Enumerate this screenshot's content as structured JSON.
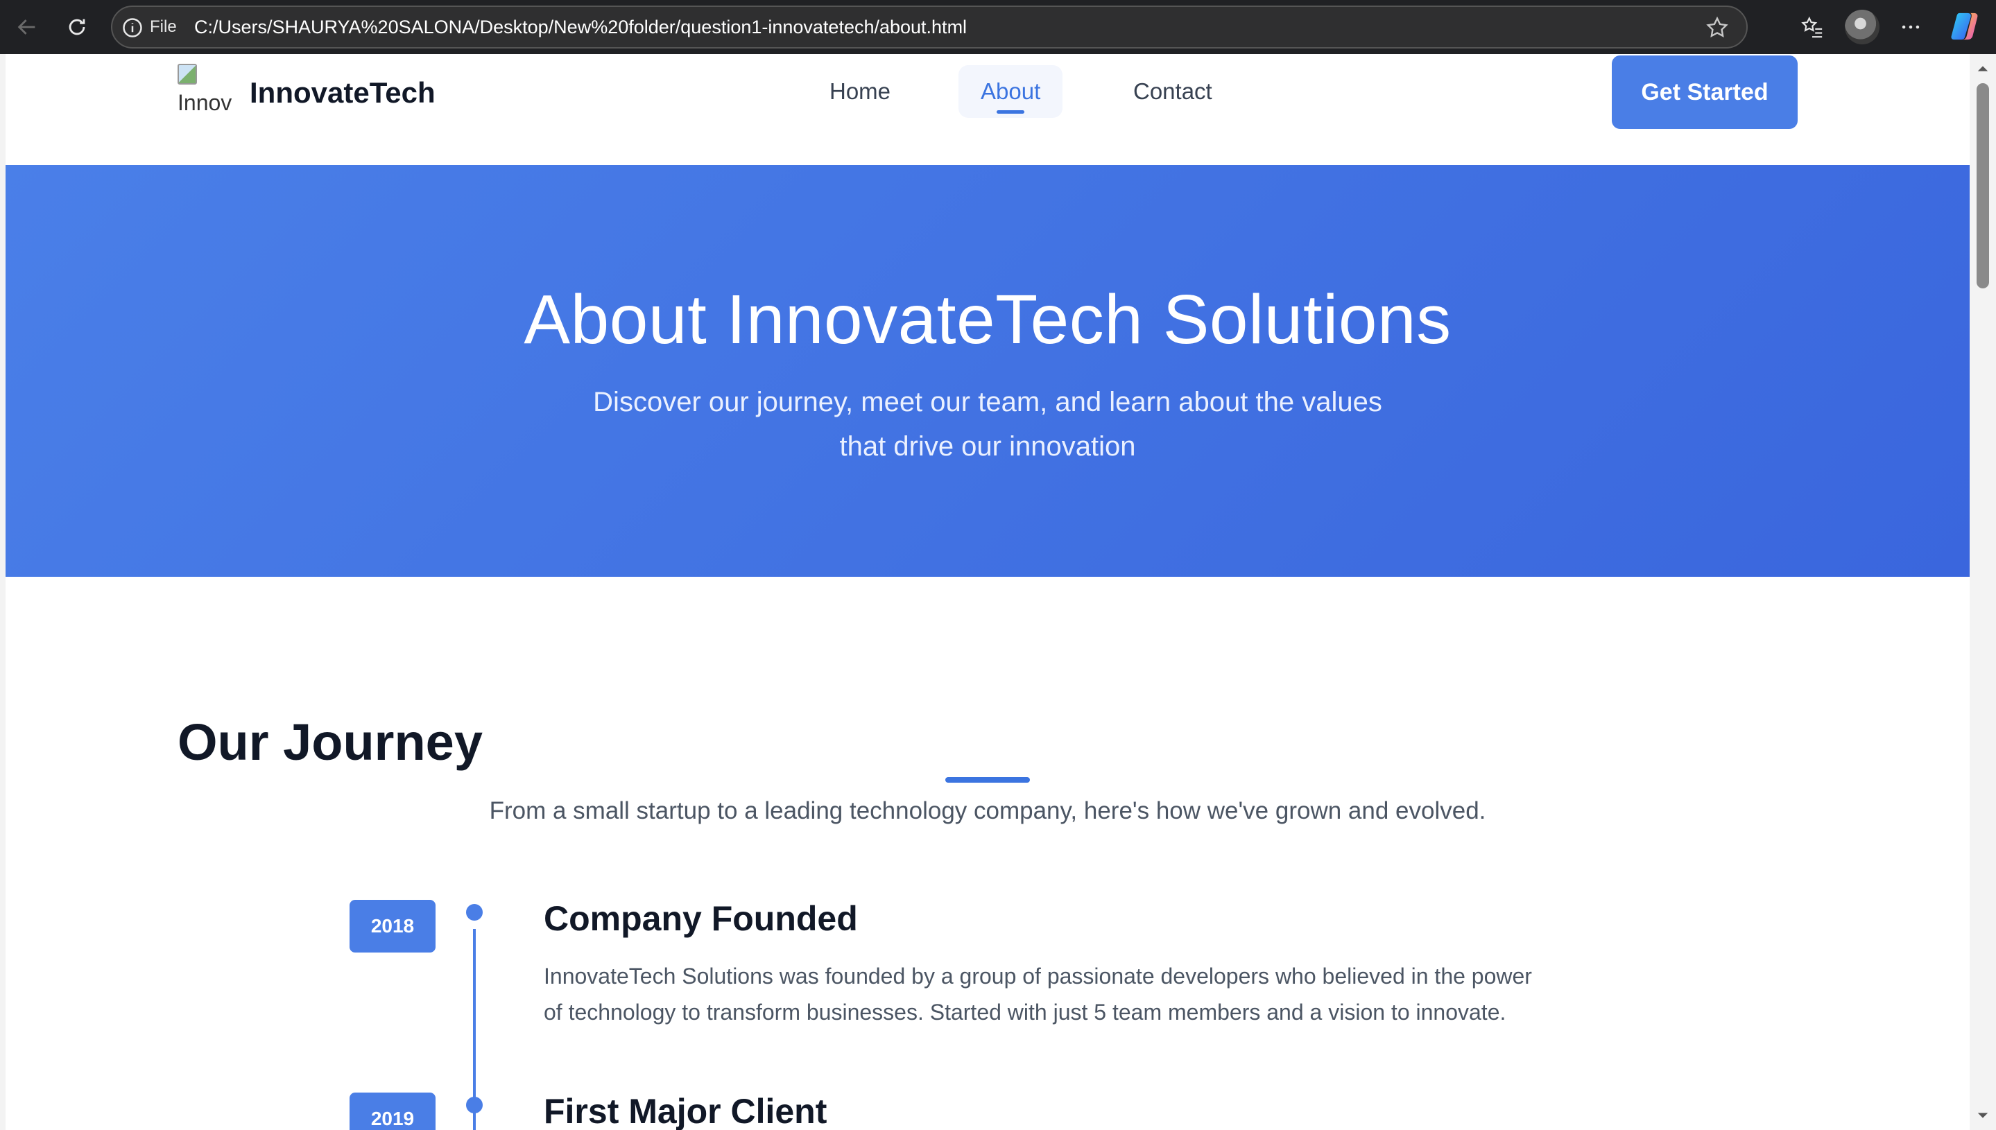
{
  "browser": {
    "file_label": "File",
    "url": "C:/Users/SHAURYA%20SALONA/Desktop/New%20folder/question1-innovatetech/about.html"
  },
  "header": {
    "logo_alt": "Innov",
    "brand": "InnovateTech",
    "nav": [
      {
        "label": "Home"
      },
      {
        "label": "About"
      },
      {
        "label": "Contact"
      }
    ],
    "cta": "Get Started"
  },
  "hero": {
    "title": "About InnovateTech Solutions",
    "subtitle": "Discover our journey, meet our team, and learn about the values that drive our innovation"
  },
  "journey": {
    "title": "Our Journey",
    "description": "From a small startup to a leading technology company, here's how we've grown and evolved.",
    "items": [
      {
        "year": "2018",
        "heading": "Company Founded",
        "text": "InnovateTech Solutions was founded by a group of passionate developers who believed in the power of technology to transform businesses. Started with just 5 team members and a vision to innovate."
      },
      {
        "year": "2019",
        "heading": "First Major Client",
        "text": ""
      }
    ]
  },
  "colors": {
    "primary": "#4a7ee6",
    "accent": "#3b74e0",
    "hero_start": "#4a7fe8",
    "hero_end": "#3a66dd"
  }
}
